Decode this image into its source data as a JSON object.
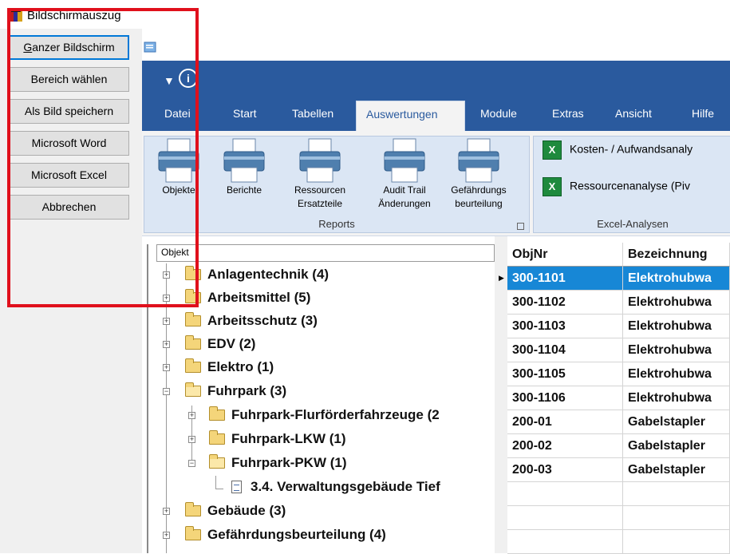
{
  "tool": {
    "title": "Bildschirmauszug",
    "buttons": [
      "Ganzer Bildschirm",
      "Bereich wählen",
      "Als  Bild speichern",
      "Microsoft Word",
      "Microsoft Excel",
      "Abbrechen"
    ]
  },
  "app": {
    "tabs": [
      "Datei",
      "Start",
      "Tabellen",
      "Auswertungen",
      "Module",
      "Extras",
      "Ansicht",
      "Hilfe"
    ],
    "active_tab": "Auswertungen",
    "reports_group": {
      "label": "Reports",
      "buttons": [
        {
          "line1": "Objekte",
          "line2": ""
        },
        {
          "line1": "Berichte",
          "line2": ""
        },
        {
          "line1": "Ressourcen",
          "line2": "Ersatzteile"
        },
        {
          "line1": "Audit Trail",
          "line2": "Änderungen"
        },
        {
          "line1": "Gefährdungs",
          "line2": "beurteilung"
        }
      ]
    },
    "excel_group": {
      "label": "Excel-Analysen",
      "items": [
        "Kosten- / Aufwandsanaly",
        "Ressourcenanalyse (Piv"
      ]
    }
  },
  "tree": {
    "header": "Objekt",
    "items": [
      {
        "label": "Anlagentechnik  (4)"
      },
      {
        "label": "Arbeitsmittel  (5)"
      },
      {
        "label": "Arbeitsschutz  (3)"
      },
      {
        "label": "EDV  (2)"
      },
      {
        "label": "Elektro  (1)"
      },
      {
        "label": "Fuhrpark  (3)"
      },
      {
        "label": "Fuhrpark-Flurförderfahrzeuge  (2"
      },
      {
        "label": "Fuhrpark-LKW  (1)"
      },
      {
        "label": "Fuhrpark-PKW  (1)"
      },
      {
        "label": "3.4. Verwaltungsgebäude Tief"
      },
      {
        "label": "Gebäude  (3)"
      },
      {
        "label": "Gefährdungsbeurteilung  (4)"
      }
    ]
  },
  "grid": {
    "columns": [
      "ObjNr",
      "Bezeichnung"
    ],
    "rows": [
      [
        "300-1101",
        "Elektrohubwa"
      ],
      [
        "300-1102",
        "Elektrohubwa"
      ],
      [
        "300-1103",
        "Elektrohubwa"
      ],
      [
        "300-1104",
        "Elektrohubwa"
      ],
      [
        "300-1105",
        "Elektrohubwa"
      ],
      [
        "300-1106",
        "Elektrohubwa"
      ],
      [
        "200-01",
        "Gabelstapler"
      ],
      [
        "200-02",
        "Gabelstapler"
      ],
      [
        "200-03",
        "Gabelstapler"
      ]
    ],
    "selected_row": 0
  },
  "colors": {
    "ribbon_blue": "#2a5a9e",
    "selection_blue": "#1787d6",
    "highlight_red": "#e0101c",
    "excel_green": "#1e8a3d",
    "folder_yellow": "#f4d57a"
  }
}
